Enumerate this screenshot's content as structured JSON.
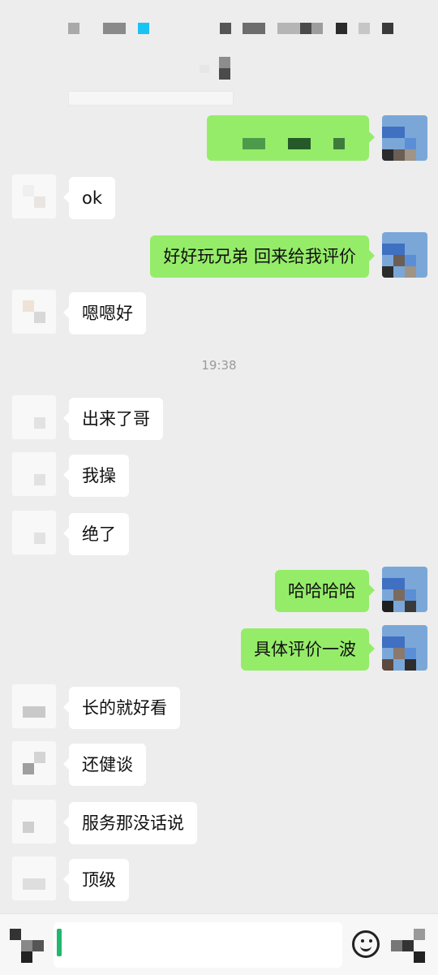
{
  "colors": {
    "background": "#ededed",
    "self_bubble": "#95ec69",
    "peer_bubble": "#ffffff",
    "timestamp": "#9a9a9a"
  },
  "status_bar": {
    "note": ""
  },
  "messages": [
    {
      "side": "peer",
      "text": "ok"
    },
    {
      "side": "self",
      "text": "好好玩兄弟 回来给我评价"
    },
    {
      "side": "peer",
      "text": "嗯嗯好"
    },
    {
      "side": "peer",
      "text": "出来了哥"
    },
    {
      "side": "peer",
      "text": "我操"
    },
    {
      "side": "peer",
      "text": "绝了"
    },
    {
      "side": "self",
      "text": "哈哈哈哈"
    },
    {
      "side": "self",
      "text": "具体评价一波"
    },
    {
      "side": "peer",
      "text": "长的就好看"
    },
    {
      "side": "peer",
      "text": "还健谈"
    },
    {
      "side": "peer",
      "text": "服务那没话说"
    },
    {
      "side": "peer",
      "text": "顶级"
    }
  ],
  "timestamp": "19:38",
  "composer": {
    "input_value": "",
    "emoji_icon": "emoji-icon",
    "more_icon": "plus-icon",
    "voice_icon": "voice-icon"
  }
}
